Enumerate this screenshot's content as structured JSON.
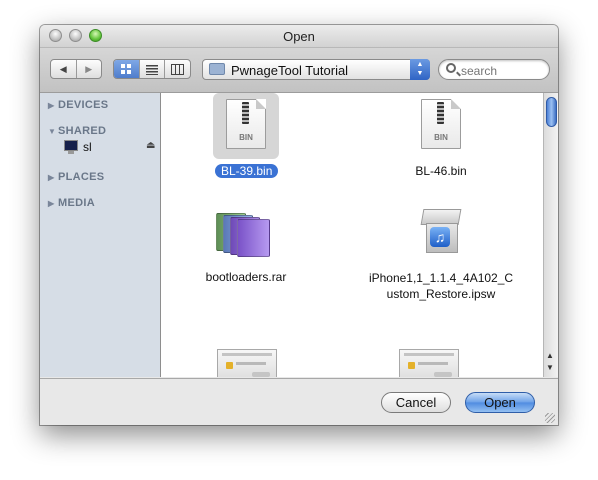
{
  "window": {
    "title": "Open"
  },
  "toolbar": {
    "back_glyph": "◀",
    "forward_glyph": "▶",
    "view_icons": [
      "icon-view-icon",
      "list-view-icon",
      "column-view-icon"
    ],
    "location": "PwnageTool Tutorial",
    "search_placeholder": "search"
  },
  "sidebar": {
    "sections": [
      {
        "label": "DEVICES",
        "expanded": false
      },
      {
        "label": "SHARED",
        "expanded": true,
        "items": [
          {
            "label": "sl",
            "icon": "monitor-icon",
            "eject": true
          }
        ]
      },
      {
        "label": "PLACES",
        "expanded": false
      },
      {
        "label": "MEDIA",
        "expanded": false
      }
    ]
  },
  "files": [
    {
      "name": "BL-39.bin",
      "icon": "bin-file-icon",
      "badge": "BIN",
      "selected": true
    },
    {
      "name": "BL-46.bin",
      "icon": "bin-file-icon",
      "badge": "BIN",
      "selected": false
    },
    {
      "name": "bootloaders.rar",
      "icon": "archive-books-icon",
      "selected": false
    },
    {
      "name_line1": "iPhone1,1_1.1.4_4A102_C",
      "name_line2": "ustom_Restore.ipsw",
      "icon": "ipsw-cube-icon",
      "selected": false
    },
    {
      "name": "",
      "icon": "screenshot-thumbnail-icon",
      "selected": false
    },
    {
      "name": "",
      "icon": "screenshot-thumbnail-icon",
      "selected": false
    }
  ],
  "buttons": {
    "cancel": "Cancel",
    "open": "Open"
  },
  "colors": {
    "selection": "#3a72d4",
    "sidebar": "#d6dde6",
    "accent": "#4f8be0"
  }
}
